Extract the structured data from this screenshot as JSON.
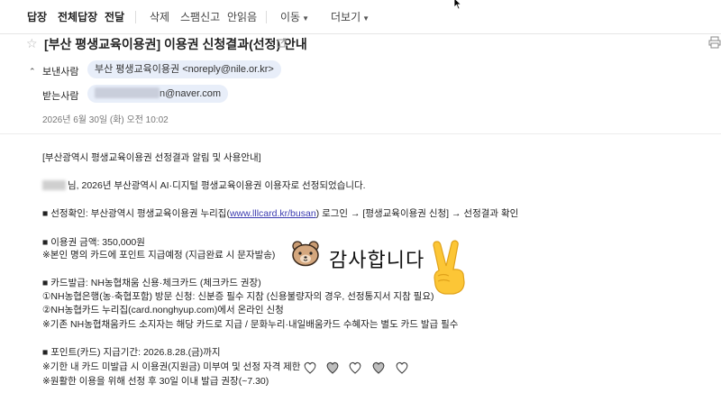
{
  "toolbar": {
    "reply": "답장",
    "reply_all": "전체답장",
    "forward": "전달",
    "delete": "삭제",
    "spam": "스팸신고",
    "mark_unread": "안읽음",
    "move": "이동",
    "more": "더보기"
  },
  "subject": "[부산 평생교육이용권] 이용권 신청결과(선정) 안내",
  "header": {
    "from_label": "보낸사람",
    "from_value": "부산 평생교육이용권 <noreply@nile.or.kr>",
    "to_label": "받는사람",
    "to_domain": "n@naver.com",
    "date": "2026년 6월 30일 (화) 오전 10:02"
  },
  "body": {
    "line1": "[부산광역시 평생교육이용권 선정결과 알림 및 사용안내]",
    "line2": "님, 2026년 부산광역시 AI·디지털 평생교육이용권 이용자로 선정되었습니다.",
    "line3_pre": "■ 선정확인: 부산광역시 평생교육이용권 누리집(",
    "line3_link": "www.lllcard.kr/busan",
    "line3_post": ") 로그인 → [평생교육이용권 신청] → 선정결과 확인",
    "line4": "■ 이용권 금액: 350,000원",
    "line5": "※본인 명의 카드에 포인트 지급예정 (지급완료 시 문자발송)",
    "line6": "■ 카드발급: NH농협채움 신용·체크카드 (체크카드 권장)",
    "line7": "①NH농협은행(농·축협포함) 방문 신청: 신분증 필수 지참 (신용불량자의 경우, 선정통지서 지참 필요)",
    "line8": "②NH농협카드 누리집(card.nonghyup.com)에서 온라인 신청",
    "line9": "※기존 NH농협채움카드 소지자는 해당 카드로 지급 / 문화누리·내일배움카드 수혜자는 별도 카드 발급 필수",
    "line10": "■ 포인트(카드) 지급기간: 2026.8.28.(금)까지",
    "line11": "※기한 내 카드 미발급 시 이용권(지원금) 미부여 및 선정 자격 제한",
    "line12": "※원활한 이용을 위해 선정 후 30일 이내 발급 권장(~7.30)"
  },
  "sticker": {
    "text": "감사합니다"
  },
  "colors": {
    "link": "#3b3bb0",
    "pill_bg": "#e8eef9"
  }
}
